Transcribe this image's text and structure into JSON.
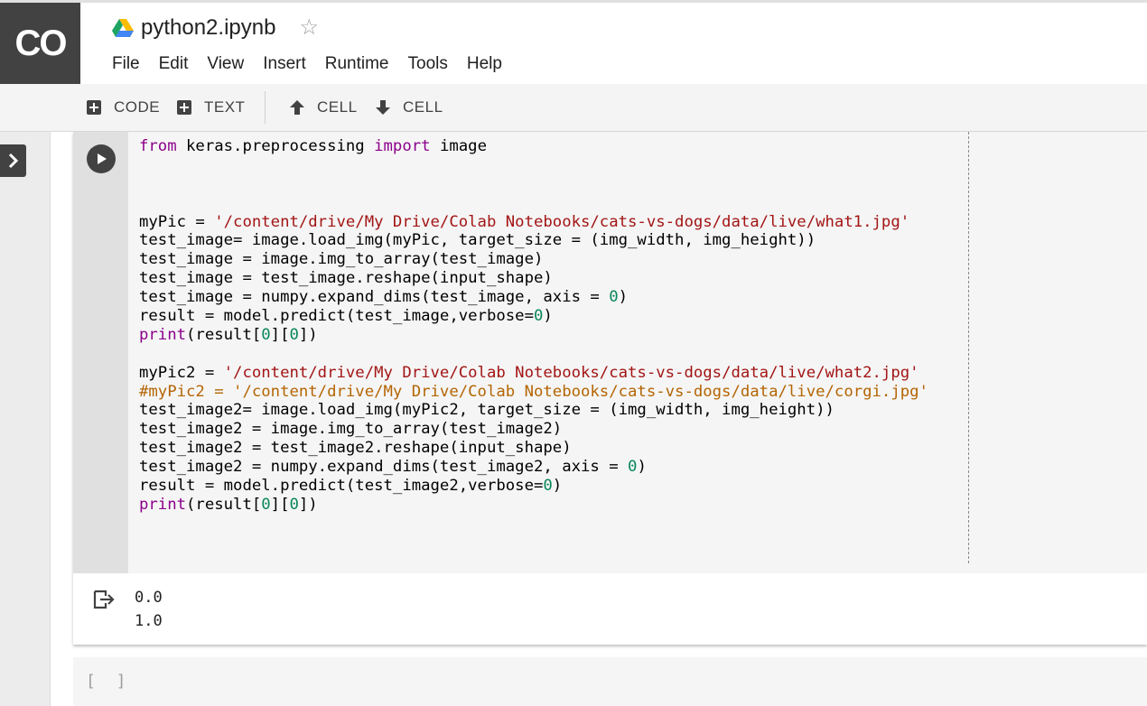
{
  "app": {
    "logo_text": "CO",
    "notebook_title": "python2.ipynb",
    "drive_icon": "google-drive-icon",
    "star_icon": "star-outline-icon"
  },
  "menu": [
    "File",
    "Edit",
    "View",
    "Insert",
    "Runtime",
    "Tools",
    "Help"
  ],
  "toolbar": {
    "add_code": "CODE",
    "add_text": "TEXT",
    "cell_up": "CELL",
    "cell_down": "CELL"
  },
  "cell": {
    "code_lines": [
      [
        [
          "kw",
          "from"
        ],
        [
          "pl",
          " keras.preprocessing "
        ],
        [
          "kw",
          "import"
        ],
        [
          "pl",
          " image"
        ]
      ],
      [],
      [],
      [],
      [
        [
          "pl",
          "myPic = "
        ],
        [
          "str",
          "'/content/drive/My Drive/Colab Notebooks/cats-vs-dogs/data/live/what1.jpg'"
        ]
      ],
      [
        [
          "pl",
          "test_image= image.load_img(myPic, target_size = (img_width, img_height))"
        ]
      ],
      [
        [
          "pl",
          "test_image = image.img_to_array(test_image)"
        ]
      ],
      [
        [
          "pl",
          "test_image = test_image.reshape(input_shape)"
        ]
      ],
      [
        [
          "pl",
          "test_image = numpy.expand_dims(test_image, axis = "
        ],
        [
          "num",
          "0"
        ],
        [
          "pl",
          ")"
        ]
      ],
      [
        [
          "pl",
          "result = model.predict(test_image,verbose="
        ],
        [
          "num",
          "0"
        ],
        [
          "pl",
          ")"
        ]
      ],
      [
        [
          "kw",
          "print"
        ],
        [
          "pl",
          "(result["
        ],
        [
          "num",
          "0"
        ],
        [
          "pl",
          "]["
        ],
        [
          "num",
          "0"
        ],
        [
          "pl",
          "])"
        ]
      ],
      [],
      [
        [
          "pl",
          "myPic2 = "
        ],
        [
          "str",
          "'/content/drive/My Drive/Colab Notebooks/cats-vs-dogs/data/live/what2.jpg'"
        ]
      ],
      [
        [
          "cmt",
          "#myPic2 = '/content/drive/My Drive/Colab Notebooks/cats-vs-dogs/data/live/corgi.jpg'"
        ]
      ],
      [
        [
          "pl",
          "test_image2= image.load_img(myPic2, target_size = (img_width, img_height))"
        ]
      ],
      [
        [
          "pl",
          "test_image2 = image.img_to_array(test_image2)"
        ]
      ],
      [
        [
          "pl",
          "test_image2 = test_image2.reshape(input_shape)"
        ]
      ],
      [
        [
          "pl",
          "test_image2 = numpy.expand_dims(test_image2, axis = "
        ],
        [
          "num",
          "0"
        ],
        [
          "pl",
          ")"
        ]
      ],
      [
        [
          "pl",
          "result = model.predict(test_image2,verbose="
        ],
        [
          "num",
          "0"
        ],
        [
          "pl",
          ")"
        ]
      ],
      [
        [
          "kw",
          "print"
        ],
        [
          "pl",
          "(result["
        ],
        [
          "num",
          "0"
        ],
        [
          "pl",
          "]["
        ],
        [
          "num",
          "0"
        ],
        [
          "pl",
          "])"
        ]
      ]
    ],
    "output_lines": [
      "0.0",
      "1.0"
    ]
  },
  "next_cell": {
    "label": "[ ]"
  },
  "colors": {
    "keyword": "#8b008b",
    "string": "#a31515",
    "number": "#098658",
    "comment": "#b46504",
    "header_dark": "#424242"
  }
}
